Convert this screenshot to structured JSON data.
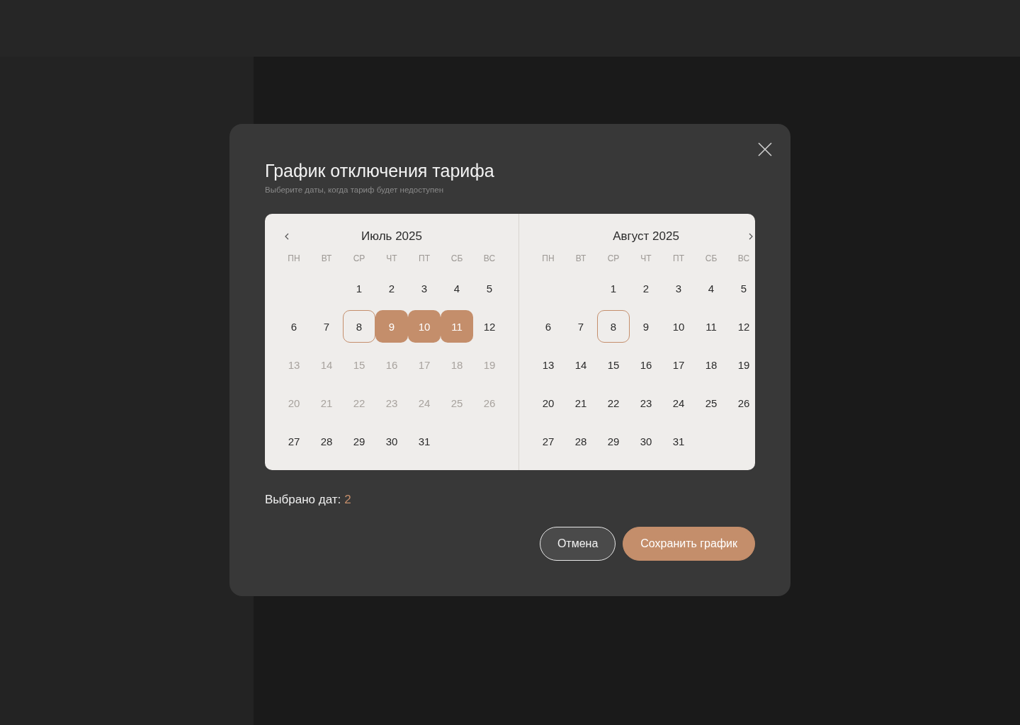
{
  "dialog": {
    "title": "График отключения тарифа",
    "subtitle": "Выберите даты, когда тариф будет недоступен"
  },
  "months": [
    {
      "title": "Июль 2025",
      "prev_button": true,
      "next_button": false,
      "weekdays": [
        "ПН",
        "ВТ",
        "СР",
        "ЧТ",
        "ПТ",
        "СБ",
        "ВС"
      ],
      "weeks": [
        [
          {
            "kind": "empty"
          },
          {
            "kind": "empty"
          },
          {
            "kind": "day",
            "label": "1",
            "selected": false,
            "today": false,
            "disabled": false
          },
          {
            "kind": "day",
            "label": "2",
            "selected": false,
            "today": false,
            "disabled": false
          },
          {
            "kind": "day",
            "label": "3",
            "selected": false,
            "today": false,
            "disabled": false
          },
          {
            "kind": "day",
            "label": "4",
            "selected": false,
            "today": false,
            "disabled": false
          },
          {
            "kind": "day",
            "label": "5",
            "selected": false,
            "today": false,
            "disabled": false
          }
        ],
        [
          {
            "kind": "day",
            "label": "6",
            "selected": false,
            "today": false,
            "disabled": false
          },
          {
            "kind": "day",
            "label": "7",
            "selected": false,
            "today": false,
            "disabled": false
          },
          {
            "kind": "day",
            "label": "8",
            "selected": false,
            "today": true,
            "disabled": false
          },
          {
            "kind": "day",
            "label": "9",
            "selected": true,
            "today": false,
            "disabled": false
          },
          {
            "kind": "day",
            "label": "10",
            "selected": true,
            "today": false,
            "disabled": false
          },
          {
            "kind": "day",
            "label": "11",
            "selected": true,
            "today": false,
            "disabled": false
          },
          {
            "kind": "day",
            "label": "12",
            "selected": false,
            "today": false,
            "disabled": false
          }
        ],
        [
          {
            "kind": "day",
            "label": "13",
            "selected": false,
            "today": false,
            "disabled": true
          },
          {
            "kind": "day",
            "label": "14",
            "selected": false,
            "today": false,
            "disabled": true
          },
          {
            "kind": "day",
            "label": "15",
            "selected": false,
            "today": false,
            "disabled": true
          },
          {
            "kind": "day",
            "label": "16",
            "selected": false,
            "today": false,
            "disabled": true
          },
          {
            "kind": "day",
            "label": "17",
            "selected": false,
            "today": false,
            "disabled": true
          },
          {
            "kind": "day",
            "label": "18",
            "selected": false,
            "today": false,
            "disabled": true
          },
          {
            "kind": "day",
            "label": "19",
            "selected": false,
            "today": false,
            "disabled": true
          }
        ],
        [
          {
            "kind": "day",
            "label": "20",
            "selected": false,
            "today": false,
            "disabled": true
          },
          {
            "kind": "day",
            "label": "21",
            "selected": false,
            "today": false,
            "disabled": true
          },
          {
            "kind": "day",
            "label": "22",
            "selected": false,
            "today": false,
            "disabled": true
          },
          {
            "kind": "day",
            "label": "23",
            "selected": false,
            "today": false,
            "disabled": true
          },
          {
            "kind": "day",
            "label": "24",
            "selected": false,
            "today": false,
            "disabled": true
          },
          {
            "kind": "day",
            "label": "25",
            "selected": false,
            "today": false,
            "disabled": true
          },
          {
            "kind": "day",
            "label": "26",
            "selected": false,
            "today": false,
            "disabled": true
          }
        ],
        [
          {
            "kind": "day",
            "label": "27",
            "selected": false,
            "today": false,
            "disabled": false
          },
          {
            "kind": "day",
            "label": "28",
            "selected": false,
            "today": false,
            "disabled": false
          },
          {
            "kind": "day",
            "label": "29",
            "selected": false,
            "today": false,
            "disabled": false
          },
          {
            "kind": "day",
            "label": "30",
            "selected": false,
            "today": false,
            "disabled": false
          },
          {
            "kind": "day",
            "label": "31",
            "selected": false,
            "today": false,
            "disabled": false
          },
          {
            "kind": "empty"
          },
          {
            "kind": "empty"
          }
        ]
      ]
    },
    {
      "title": "Август 2025",
      "prev_button": false,
      "next_button": true,
      "weekdays": [
        "ПН",
        "ВТ",
        "СР",
        "ЧТ",
        "ПТ",
        "СБ",
        "ВС"
      ],
      "weeks": [
        [
          {
            "kind": "empty"
          },
          {
            "kind": "empty"
          },
          {
            "kind": "day",
            "label": "1",
            "selected": false,
            "today": false,
            "disabled": false
          },
          {
            "kind": "day",
            "label": "2",
            "selected": false,
            "today": false,
            "disabled": false
          },
          {
            "kind": "day",
            "label": "3",
            "selected": false,
            "today": false,
            "disabled": false
          },
          {
            "kind": "day",
            "label": "4",
            "selected": false,
            "today": false,
            "disabled": false
          },
          {
            "kind": "day",
            "label": "5",
            "selected": false,
            "today": false,
            "disabled": false
          }
        ],
        [
          {
            "kind": "day",
            "label": "6",
            "selected": false,
            "today": false,
            "disabled": false
          },
          {
            "kind": "day",
            "label": "7",
            "selected": false,
            "today": false,
            "disabled": false
          },
          {
            "kind": "day",
            "label": "8",
            "selected": false,
            "today": true,
            "disabled": false
          },
          {
            "kind": "day",
            "label": "9",
            "selected": false,
            "today": false,
            "disabled": false
          },
          {
            "kind": "day",
            "label": "10",
            "selected": false,
            "today": false,
            "disabled": false
          },
          {
            "kind": "day",
            "label": "11",
            "selected": false,
            "today": false,
            "disabled": false
          },
          {
            "kind": "day",
            "label": "12",
            "selected": false,
            "today": false,
            "disabled": false
          }
        ],
        [
          {
            "kind": "day",
            "label": "13",
            "selected": false,
            "today": false,
            "disabled": false
          },
          {
            "kind": "day",
            "label": "14",
            "selected": false,
            "today": false,
            "disabled": false
          },
          {
            "kind": "day",
            "label": "15",
            "selected": false,
            "today": false,
            "disabled": false
          },
          {
            "kind": "day",
            "label": "16",
            "selected": false,
            "today": false,
            "disabled": false
          },
          {
            "kind": "day",
            "label": "17",
            "selected": false,
            "today": false,
            "disabled": false
          },
          {
            "kind": "day",
            "label": "18",
            "selected": false,
            "today": false,
            "disabled": false
          },
          {
            "kind": "day",
            "label": "19",
            "selected": false,
            "today": false,
            "disabled": false
          }
        ],
        [
          {
            "kind": "day",
            "label": "20",
            "selected": false,
            "today": false,
            "disabled": false
          },
          {
            "kind": "day",
            "label": "21",
            "selected": false,
            "today": false,
            "disabled": false
          },
          {
            "kind": "day",
            "label": "22",
            "selected": false,
            "today": false,
            "disabled": false
          },
          {
            "kind": "day",
            "label": "23",
            "selected": false,
            "today": false,
            "disabled": false
          },
          {
            "kind": "day",
            "label": "24",
            "selected": false,
            "today": false,
            "disabled": false
          },
          {
            "kind": "day",
            "label": "25",
            "selected": false,
            "today": false,
            "disabled": false
          },
          {
            "kind": "day",
            "label": "26",
            "selected": false,
            "today": false,
            "disabled": false
          }
        ],
        [
          {
            "kind": "day",
            "label": "27",
            "selected": false,
            "today": false,
            "disabled": false
          },
          {
            "kind": "day",
            "label": "28",
            "selected": false,
            "today": false,
            "disabled": false
          },
          {
            "kind": "day",
            "label": "29",
            "selected": false,
            "today": false,
            "disabled": false
          },
          {
            "kind": "day",
            "label": "30",
            "selected": false,
            "today": false,
            "disabled": false
          },
          {
            "kind": "day",
            "label": "31",
            "selected": false,
            "today": false,
            "disabled": false
          },
          {
            "kind": "empty"
          },
          {
            "kind": "empty"
          }
        ]
      ]
    }
  ],
  "selection": {
    "label": "Выбрано дат:",
    "count": "2"
  },
  "buttons": [
    {
      "label": "Отмена",
      "kind": "secondary"
    },
    {
      "label": "Сохранить график",
      "kind": "primary"
    }
  ]
}
